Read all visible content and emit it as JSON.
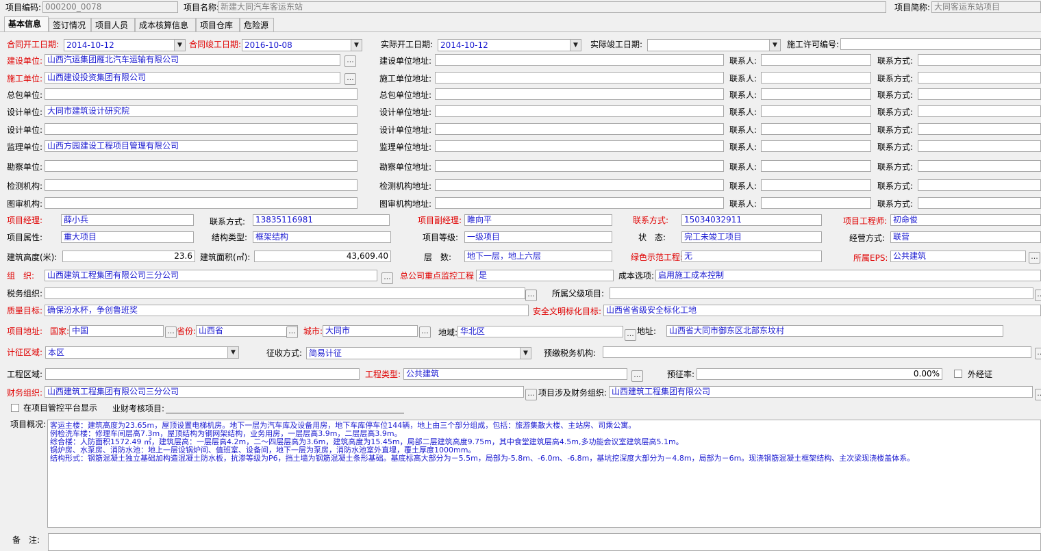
{
  "header": {
    "code_label": "项目编码:",
    "code_value": "000200_0078",
    "name_label": "项目名称:",
    "name_value": "新建大同汽车客运东站",
    "short_label": "项目简称:",
    "short_value": "大同客运东站项目"
  },
  "tabs": [
    {
      "label": "基本信息"
    },
    {
      "label": "签订情况"
    },
    {
      "label": "项目人员"
    },
    {
      "label": "成本核算信息"
    },
    {
      "label": "项目仓库"
    },
    {
      "label": "危险源"
    }
  ],
  "dates": {
    "contract_start_label": "合同开工日期:",
    "contract_start": "2014-10-12",
    "contract_end_label": "合同竣工日期:",
    "contract_end": "2016-10-08",
    "actual_start_label": "实际开工日期:",
    "actual_start": "2014-10-12",
    "actual_end_label": "实际竣工日期:",
    "actual_end": "",
    "permit_label": "施工许可编号:",
    "permit": ""
  },
  "units": [
    {
      "label": "建设单位:",
      "value": "山西汽运集团雁北汽车运输有限公司",
      "addr_label": "建设单位地址:",
      "contact_label": "联系人:",
      "phone_label": "联系方式:"
    },
    {
      "label": "施工单位:",
      "value": "山西建设投资集团有限公司",
      "addr_label": "施工单位地址:",
      "contact_label": "联系人:",
      "phone_label": "联系方式:"
    },
    {
      "label": "总包单位:",
      "value": "",
      "addr_label": "总包单位地址:",
      "contact_label": "联系人:",
      "phone_label": "联系方式:"
    },
    {
      "label": "设计单位:",
      "value": "大同市建筑设计研究院",
      "addr_label": "设计单位地址:",
      "contact_label": "联系人:",
      "phone_label": "联系方式:"
    },
    {
      "label": "设计单位:",
      "value": "",
      "addr_label": "设计单位地址:",
      "contact_label": "联系人:",
      "phone_label": "联系方式:"
    },
    {
      "label": "监理单位:",
      "value": "山西方园建设工程项目管理有限公司",
      "addr_label": "监理单位地址:",
      "contact_label": "联系人:",
      "phone_label": "联系方式:"
    },
    {
      "label": "勘察单位:",
      "value": "",
      "addr_label": "勘察单位地址:",
      "contact_label": "联系人:",
      "phone_label": "联系方式:"
    },
    {
      "label": "检测机构:",
      "value": "",
      "addr_label": "检测机构地址:",
      "contact_label": "联系人:",
      "phone_label": "联系方式:"
    },
    {
      "label": "图审机构:",
      "value": "",
      "addr_label": "图审机构地址:",
      "contact_label": "联系人:",
      "phone_label": "联系方式:"
    }
  ],
  "people": {
    "pm_label": "项目经理:",
    "pm": "薛小兵",
    "pm_phone_label": "联系方式:",
    "pm_phone": "13835116981",
    "vpm_label": "项目副经理:",
    "vpm": "睢向平",
    "vpm_phone_label": "联系方式:",
    "vpm_phone": "15034032911",
    "eng_label": "项目工程师:",
    "eng": "初命俊"
  },
  "attrs": {
    "attr_label": "项目属性:",
    "attr": "重大项目",
    "struct_label": "结构类型:",
    "struct": "框架结构",
    "level_label": "项目等级:",
    "level": "一级项目",
    "status_label": "状　态:",
    "status": "完工未竣工项目",
    "mode_label": "经营方式:",
    "mode": "联营"
  },
  "building": {
    "height_label": "建筑高度(米):",
    "height": "23.6",
    "area_label": "建筑面积(㎡):",
    "area": "43,609.40",
    "floors_label": "层　数:",
    "floors": "地下一层，地上六层",
    "green_label": "绿色示范工程:",
    "green": "无",
    "eps_label": "所属EPS:",
    "eps": "公共建筑"
  },
  "org": {
    "org_label": "组　织:",
    "org": "山西建筑工程集团有限公司三分公司",
    "monitor_label": "总公司重点监控工程",
    "monitor": "是",
    "cost_label": "成本选项:",
    "cost": "启用施工成本控制",
    "tax_label": "税务组织:",
    "tax": "",
    "parent_label": "所属父级项目:",
    "parent": "",
    "quality_label": "质量目标:",
    "quality": "确保汾水杯，争创鲁班奖",
    "safety_label": "安全文明标化目标:",
    "safety": "山西省省级安全标化工地"
  },
  "address": {
    "label": "项目地址:",
    "country_label": "国家:",
    "country": "中国",
    "province_label": "省份:",
    "province": "山西省",
    "city_label": "城市:",
    "city": "大同市",
    "region_label": "地域:",
    "region": "华北区",
    "addr_label": "地址:",
    "addr": "山西省大同市御东区北部东坟村"
  },
  "tax": {
    "area_label": "计征区域:",
    "area": "本区",
    "method_label": "征收方式:",
    "method": "简易计征",
    "agency_label": "预缴税务机构:",
    "agency": ""
  },
  "project": {
    "region_label": "工程区域:",
    "region": "",
    "type_label": "工程类型:",
    "type": "公共建筑",
    "rate_label": "预征率:",
    "rate": "0.00%",
    "external_label": "外经证",
    "fin_label": "财务组织:",
    "fin": "山西建筑工程集团有限公司三分公司",
    "fin_related_label": "项目涉及财务组织:",
    "fin_related": "山西建筑工程集团有限公司",
    "platform_label": "在项目管控平台显示",
    "review_label": "业财考核项目:"
  },
  "overview": {
    "label": "项目概况:",
    "lines": [
      "客运主楼：建筑高度为23.65m，屋顶设置电梯机房。地下一层为汽车库及设备用房，地下车库停车位144辆，地上由三个部分组成，包括：旅游集散大楼、主站房、司乘公寓。",
      "例检洗车楼：修理车间层高7.3m，屋顶结构为钢网架结构，业务用房，一层层高3.9m，二层层高3.9m。",
      "综合楼：人防面积1572.49 ㎡，建筑层高：一层层高4.2m，二～四层层高为3.6m，建筑高度为15.45m，局部二层建筑高度9.75m，其中食堂建筑层高4.5m,多功能会议室建筑层高5.1m。",
      "锅炉房、水泵房、消防水池：地上一层设锅炉间、值班室、设备间，地下一层为泵房，消防水池室外直埋，覆土厚度1000mm。",
      "结构形式：钢筋混凝土独立基础加构造混凝土防水板，抗渗等级为P6，挡土墙为钢筋混凝土条形基础。基底标高大部分为－5.5m，局部为-5.8m、-6.0m、-6.8m，基坑挖深度大部分为－4.8m，局部为－6m。现浇钢筋混凝土框架结构、主次梁现浇楼盖体系。"
    ],
    "remark_label": "备　注:"
  },
  "icons": {
    "ellipsis": "...",
    "dropdown": "▼"
  },
  "colors": {
    "required_label": "#e00000",
    "value_text": "#1a1ad0",
    "background": "#f0f0f0"
  }
}
